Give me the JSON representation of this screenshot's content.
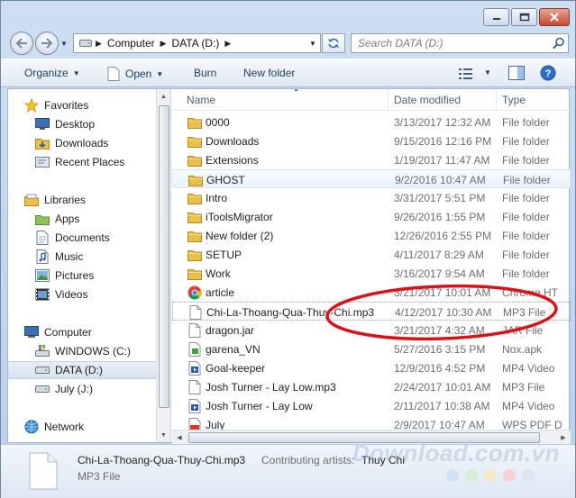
{
  "window": {
    "caption_buttons": [
      "minimize",
      "maximize",
      "close"
    ]
  },
  "address": {
    "segments": [
      "Computer",
      "DATA (D:)"
    ],
    "search_placeholder": "Search DATA (D:)"
  },
  "toolbar": {
    "organize": "Organize",
    "open": "Open",
    "burn": "Burn",
    "new_folder": "New folder"
  },
  "nav": {
    "favorites": "Favorites",
    "desktop": "Desktop",
    "downloads": "Downloads",
    "recent_places": "Recent Places",
    "libraries": "Libraries",
    "apps": "Apps",
    "documents": "Documents",
    "music": "Music",
    "pictures": "Pictures",
    "videos": "Videos",
    "computer": "Computer",
    "windows_c": "WINDOWS (C:)",
    "data_d": "DATA (D:)",
    "july_j": "July (J:)",
    "network": "Network"
  },
  "columns": {
    "name": "Name",
    "date_modified": "Date modified",
    "type": "Type"
  },
  "files": [
    {
      "name": "0000",
      "date": "3/13/2017 12:32 AM",
      "type": "File folder",
      "icon": "folder-icon"
    },
    {
      "name": "Downloads",
      "date": "9/15/2016 12:16 PM",
      "type": "File folder",
      "icon": "folder-icon"
    },
    {
      "name": "Extensions",
      "date": "1/19/2017 11:47 AM",
      "type": "File folder",
      "icon": "folder-icon"
    },
    {
      "name": "GHOST",
      "date": "9/2/2016 10:47 AM",
      "type": "File folder",
      "icon": "folder-icon"
    },
    {
      "name": "Intro",
      "date": "3/31/2017 5:51 PM",
      "type": "File folder",
      "icon": "folder-icon"
    },
    {
      "name": "iToolsMigrator",
      "date": "9/26/2016 1:55 PM",
      "type": "File folder",
      "icon": "folder-icon"
    },
    {
      "name": "New folder (2)",
      "date": "12/26/2016 2:55 PM",
      "type": "File folder",
      "icon": "folder-icon"
    },
    {
      "name": "SETUP",
      "date": "4/11/2017 8:29 AM",
      "type": "File folder",
      "icon": "folder-icon"
    },
    {
      "name": "Work",
      "date": "3/16/2017 9:54 AM",
      "type": "File folder",
      "icon": "folder-icon"
    },
    {
      "name": "article",
      "date": "3/21/2017 10:01 AM",
      "type": "Chrome HT",
      "icon": "chrome-icon"
    },
    {
      "name": "Chi-La-Thoang-Qua-Thuy-Chi.mp3",
      "date": "4/12/2017 10:30 AM",
      "type": "MP3 File",
      "icon": "blank-file-icon"
    },
    {
      "name": "dragon.jar",
      "date": "3/21/2017 4:32 AM",
      "type": "JAR File",
      "icon": "blank-file-icon"
    },
    {
      "name": "garena_VN",
      "date": "5/27/2016 3:15 PM",
      "type": "Nox.apk",
      "icon": "apk-icon"
    },
    {
      "name": "Goal-keeper",
      "date": "12/9/2016 4:52 PM",
      "type": "MP4 Video",
      "icon": "video-file-icon"
    },
    {
      "name": "Josh Turner - Lay Low.mp3",
      "date": "2/24/2017 10:01 AM",
      "type": "MP3 File",
      "icon": "blank-file-icon"
    },
    {
      "name": "Josh Turner - Lay Low",
      "date": "2/11/2017 10:38 AM",
      "type": "MP4 Video",
      "icon": "video-file-icon"
    },
    {
      "name": "July",
      "date": "2/9/2017 10:47 AM",
      "type": "WPS PDF D",
      "icon": "pdf-icon"
    }
  ],
  "details": {
    "name": "Chi-La-Thoang-Qua-Thuy-Chi.mp3",
    "label": "Contributing artists:",
    "value": "Thuy Chi",
    "type": "MP3 File"
  },
  "watermark": "Download.com.vn",
  "colors": {
    "annotation": "#d8121b",
    "folder": "#e8c04a",
    "accent": "#1e395b"
  }
}
